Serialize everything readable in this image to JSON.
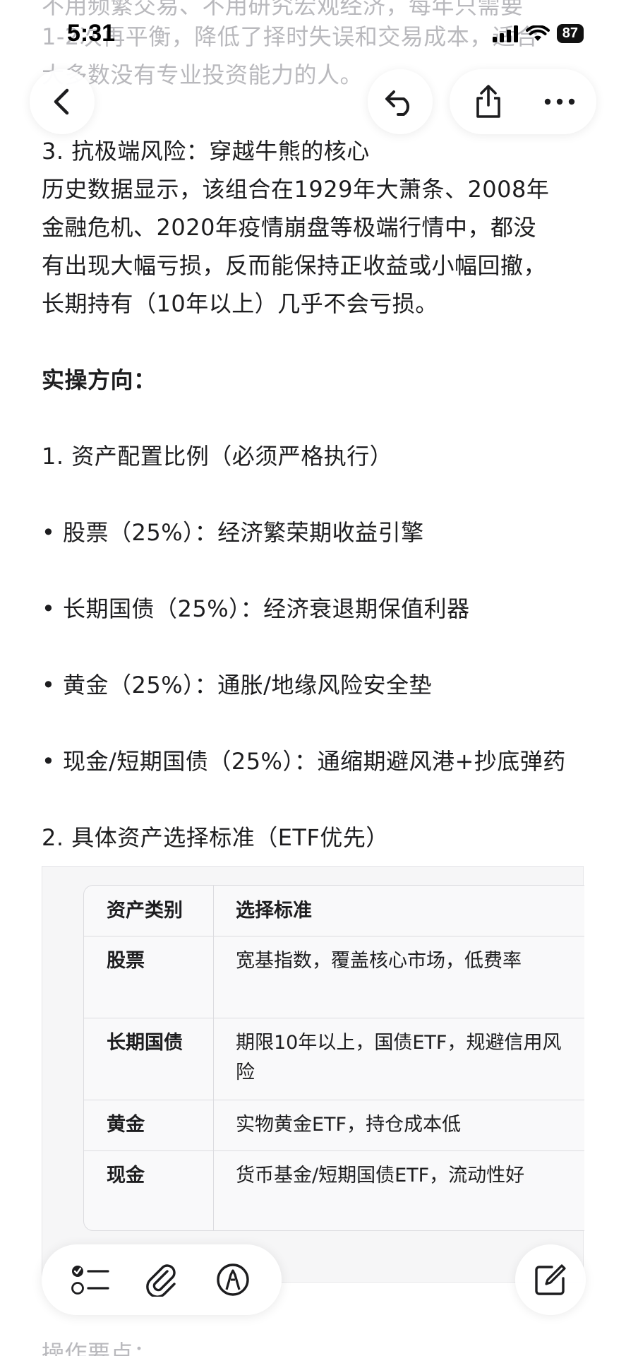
{
  "status_bar": {
    "time": "5:31",
    "battery": "87"
  },
  "content": {
    "top_faded_1": "不用频繁交易、不用研究宏观经济，每年只需要",
    "top_faded_2": "1-2次再平衡，降低了择时失误和交易成本，适合",
    "top_faded_3": "大多数没有专业投资能力的人。",
    "heading_3": "3. 抗极端风险：穿越牛熊的核心",
    "para_1": "历史数据显示，该组合在1929年大萧条、2008年",
    "para_2": "金融危机、2020年疫情崩盘等极端行情中，都没",
    "para_3": "有出现大幅亏损，反而能保持正收益或小幅回撤，",
    "para_4": "长期持有（10年以上）几乎不会亏损。",
    "section_title": "实操方向：",
    "sub_1": "1. 资产配置比例（必须严格执行）",
    "bullet_1": "• 股票（25%）：经济繁荣期收益引擎",
    "bullet_2": "• 长期国债（25%）：经济衰退期保值利器",
    "bullet_3": "• 黄金（25%）：通胀/地缘风险安全垫",
    "bullet_4": "• 现金/短期国债（25%）：通缩期避风港+抄底弹药",
    "sub_2": "2. 具体资产选择标准（ETF优先）",
    "bottom_faded": "操作要点："
  },
  "table": {
    "headers": [
      "资产类别",
      "选择标准"
    ],
    "rows": [
      {
        "category": "股票",
        "criteria": "宽基指数，覆盖核心市场，低费率"
      },
      {
        "category": "长期国债",
        "criteria": "期限10年以上，国债ETF，规避信用风险"
      },
      {
        "category": "黄金",
        "criteria": "实物黄金ETF，持仓成本低"
      },
      {
        "category": "现金",
        "criteria": "货币基金/短期国债ETF，流动性好"
      }
    ]
  },
  "icons": {
    "back": "chevron-left-icon",
    "undo": "undo-arrow-icon",
    "share": "share-icon",
    "more": "more-dots-icon",
    "checklist": "checklist-icon",
    "attach": "paperclip-icon",
    "markup": "pen-markup-icon",
    "compose": "compose-icon"
  }
}
